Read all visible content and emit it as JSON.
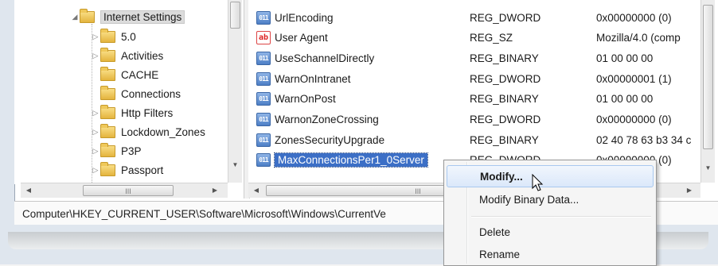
{
  "tree": {
    "items": [
      {
        "label": "Internet Settings",
        "expanded": true,
        "selected": true
      },
      {
        "label": "5.0",
        "expandable": true
      },
      {
        "label": "Activities",
        "expandable": true
      },
      {
        "label": "CACHE",
        "expandable": false
      },
      {
        "label": "Connections",
        "expandable": false
      },
      {
        "label": "Http Filters",
        "expandable": true
      },
      {
        "label": "Lockdown_Zones",
        "expandable": true
      },
      {
        "label": "P3P",
        "expandable": true
      },
      {
        "label": "Passport",
        "expandable": true
      }
    ]
  },
  "list": {
    "rows": [
      {
        "name": "UrlEncoding",
        "icon": "binary-value-icon",
        "type": "REG_DWORD",
        "data": "0x00000000 (0)"
      },
      {
        "name": "User Agent",
        "icon": "string-value-icon",
        "type": "REG_SZ",
        "data": "Mozilla/4.0 (comp"
      },
      {
        "name": "UseSchannelDirectly",
        "icon": "binary-value-icon",
        "type": "REG_BINARY",
        "data": "01 00 00 00"
      },
      {
        "name": "WarnOnIntranet",
        "icon": "binary-value-icon",
        "type": "REG_DWORD",
        "data": "0x00000001 (1)"
      },
      {
        "name": "WarnOnPost",
        "icon": "binary-value-icon",
        "type": "REG_BINARY",
        "data": "01 00 00 00"
      },
      {
        "name": "WarnonZoneCrossing",
        "icon": "binary-value-icon",
        "type": "REG_DWORD",
        "data": "0x00000000 (0)"
      },
      {
        "name": "ZonesSecurityUpgrade",
        "icon": "binary-value-icon",
        "type": "REG_BINARY",
        "data": "02 40 78 63 b3 34 c"
      },
      {
        "name": "MaxConnectionsPer1_0Server",
        "icon": "binary-value-icon",
        "type": "REG_DWORD",
        "data": "0x00000000 (0)",
        "selected": true
      }
    ]
  },
  "statusbar": {
    "path": "Computer\\HKEY_CURRENT_USER\\Software\\Microsoft\\Windows\\CurrentVe"
  },
  "context_menu": {
    "items": [
      {
        "label": "Modify...",
        "hover": true
      },
      {
        "label": "Modify Binary Data..."
      },
      {
        "label": "Delete"
      },
      {
        "label": "Rename"
      }
    ]
  },
  "scrollbars": {
    "tree_h_thumb": "III",
    "list_h_thumb": "III"
  },
  "colors": {
    "selection": "#3c6fc6",
    "folder": "#e4b43e",
    "menu_hover": "#dbe8fa"
  }
}
